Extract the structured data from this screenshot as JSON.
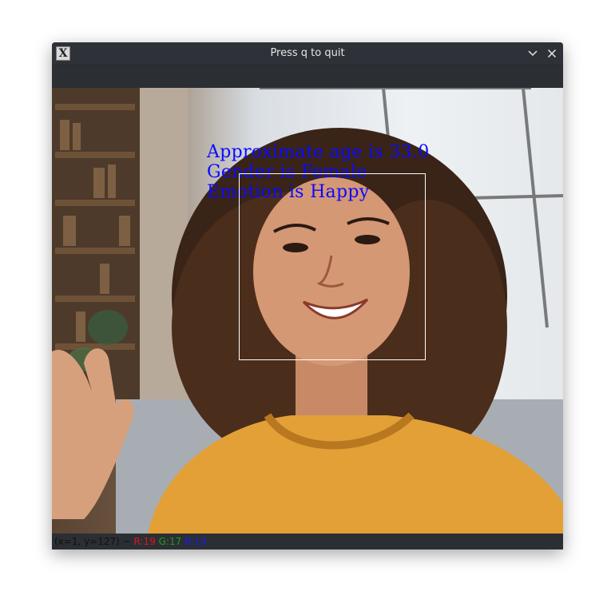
{
  "window": {
    "title": "Press q to quit",
    "app_icon_glyph": "X",
    "minimize_icon": "chevron-down-icon",
    "close_icon": "close-icon"
  },
  "overlay": {
    "age_text": "Approximate age is 33.0",
    "gender_text": "Gender is Female",
    "emotion_text": "Emotion is Happy",
    "text_color": "#0a0aff",
    "box_color": "#ffffff"
  },
  "status_bar": {
    "coords": "(x=1, y=127) ~",
    "r": "R:19",
    "g": "G:17",
    "b": "B:15",
    "r_color": "#e0141e",
    "g_color": "#1f9d1f",
    "b_color": "#1a1aff"
  }
}
